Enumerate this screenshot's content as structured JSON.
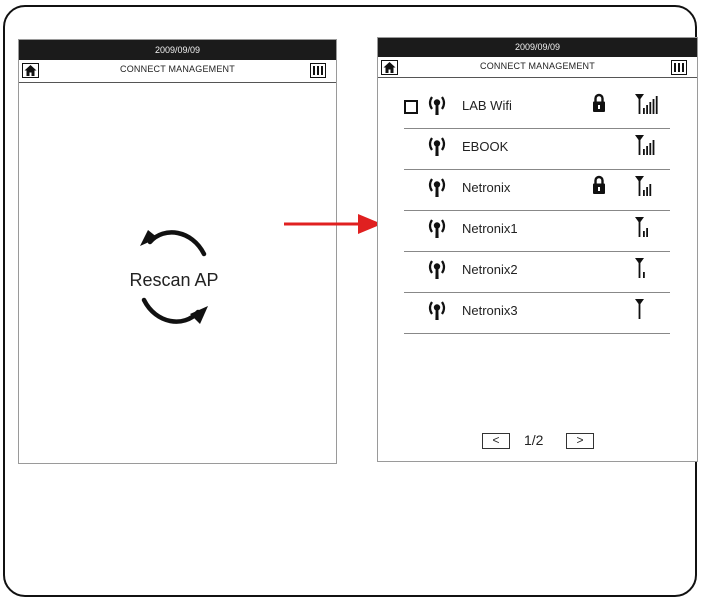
{
  "left_screen": {
    "date": "2009/09/09",
    "title": "CONNECT MANAGEMENT",
    "rescan_label": "Rescan AP",
    "icons": {
      "home": "home-icon",
      "battery": "battery-icon",
      "rescan": "refresh-arrows-icon"
    }
  },
  "transition": {
    "icon": "red-right-arrow-icon",
    "color": "#e02020"
  },
  "right_screen": {
    "date": "2009/09/09",
    "title": "CONNECT MANAGEMENT",
    "icons": {
      "home": "home-icon",
      "battery": "battery-icon"
    },
    "access_points": [
      {
        "name": "LAB Wifi",
        "checkbox": true,
        "locked": true,
        "signal_bars": 5
      },
      {
        "name": "EBOOK",
        "checkbox": false,
        "locked": false,
        "signal_bars": 4
      },
      {
        "name": "Netronix",
        "checkbox": false,
        "locked": true,
        "signal_bars": 3
      },
      {
        "name": "Netronix1",
        "checkbox": false,
        "locked": false,
        "signal_bars": 2
      },
      {
        "name": "Netronix2",
        "checkbox": false,
        "locked": false,
        "signal_bars": 1
      },
      {
        "name": "Netronix3",
        "checkbox": false,
        "locked": false,
        "signal_bars": 0
      }
    ],
    "pager": {
      "prev": "<",
      "page": "1/2",
      "next": ">"
    }
  }
}
